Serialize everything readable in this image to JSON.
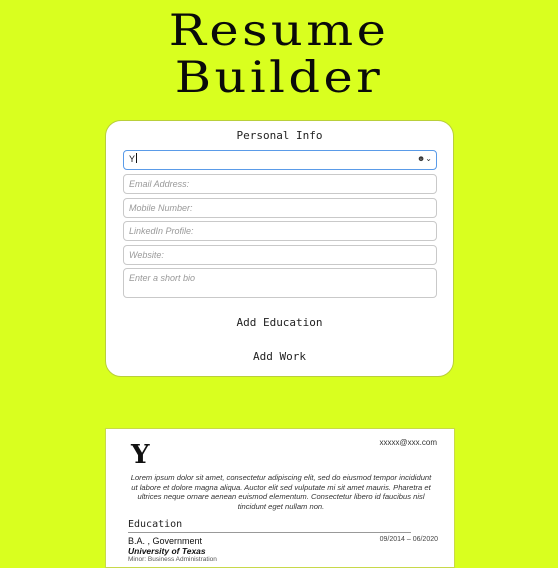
{
  "app": {
    "title_line1": "Resume",
    "title_line2": "Builder"
  },
  "form": {
    "heading": "Personal Info",
    "name_value": "Y",
    "email_placeholder": "Email Address:",
    "mobile_placeholder": "Mobile Number:",
    "linkedin_placeholder": "LinkedIn Profile:",
    "website_placeholder": "Website:",
    "bio_placeholder": "Enter a short bio",
    "autofill_icon": "☻⌄",
    "add_education_label": "Add Education",
    "add_work_label": "Add Work"
  },
  "preview": {
    "initial": "Y",
    "email": "xxxxx@xxx.com",
    "bio": "Lorem ipsum dolor sit amet, consectetur adipiscing elit, sed do eiusmod tempor incididunt ut labore et dolore magna aliqua. Auctor elit sed vulputate mi sit amet mauris. Pharetra et ultrices neque ornare aenean euismod elementum. Consectetur libero id faucibus nisl tincidunt eget nullam non.",
    "education_title": "Education",
    "degree": "B.A. , Government",
    "dates": "09/2014 – 06/2020",
    "school": "University of Texas",
    "minor": "Minor: Business Administration"
  }
}
